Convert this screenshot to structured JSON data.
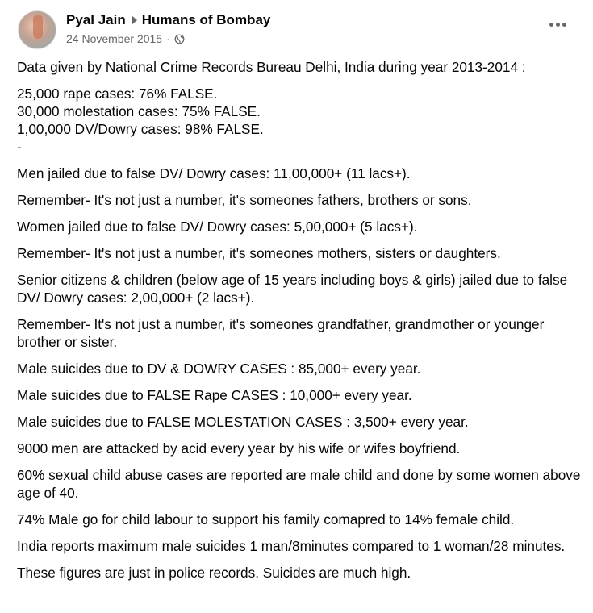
{
  "post": {
    "author": "Pyal Jain",
    "page": "Humans of Bombay",
    "date": "24 November 2015",
    "separator": "·"
  },
  "content": {
    "intro": "Data given by National Crime Records Bureau Delhi, India during year 2013-2014 :",
    "stats": [
      "25,000 rape cases: 76% FALSE.",
      "30,000 molestation cases: 75% FALSE.",
      "1,00,000 DV/Dowry cases: 98% FALSE.",
      "-"
    ],
    "paragraphs": [
      "Men jailed due to false DV/ Dowry cases: 11,00,000+ (11 lacs+).",
      "Remember- It's not just a number, it's someones fathers, brothers or sons.",
      "Women jailed due to false DV/ Dowry cases: 5,00,000+ (5 lacs+).",
      "Remember- It's not just a number, it's someones mothers, sisters or daughters.",
      "Senior citizens & children (below age of 15 years including boys & girls) jailed due to false DV/ Dowry cases: 2,00,000+ (2 lacs+).",
      "Remember- It's not just a number, it's someones grandfather, grandmother or younger brother or sister.",
      "Male suicides due to DV & DOWRY CASES : 85,000+ every year.",
      "Male suicides due to FALSE Rape CASES : 10,000+ every year.",
      "Male suicides due to FALSE MOLESTATION CASES : 3,500+ every year.",
      "9000 men are attacked by acid every year by his wife or wifes boyfriend.",
      "60% sexual child abuse cases are reported are male child and done by some women above age of 40.",
      "74% Male go for child labour to support his family comapred to 14% female child.",
      "India reports maximum male suicides 1 man/8minutes compared to 1 woman/28 minutes.",
      "These figures are just in police records. Suicides are much high."
    ]
  },
  "icons": {
    "audience": "globe-icon",
    "menu": "more-icon",
    "share_arrow": "caret-right-icon"
  },
  "colors": {
    "text": "#050505",
    "secondary": "#65676b"
  }
}
